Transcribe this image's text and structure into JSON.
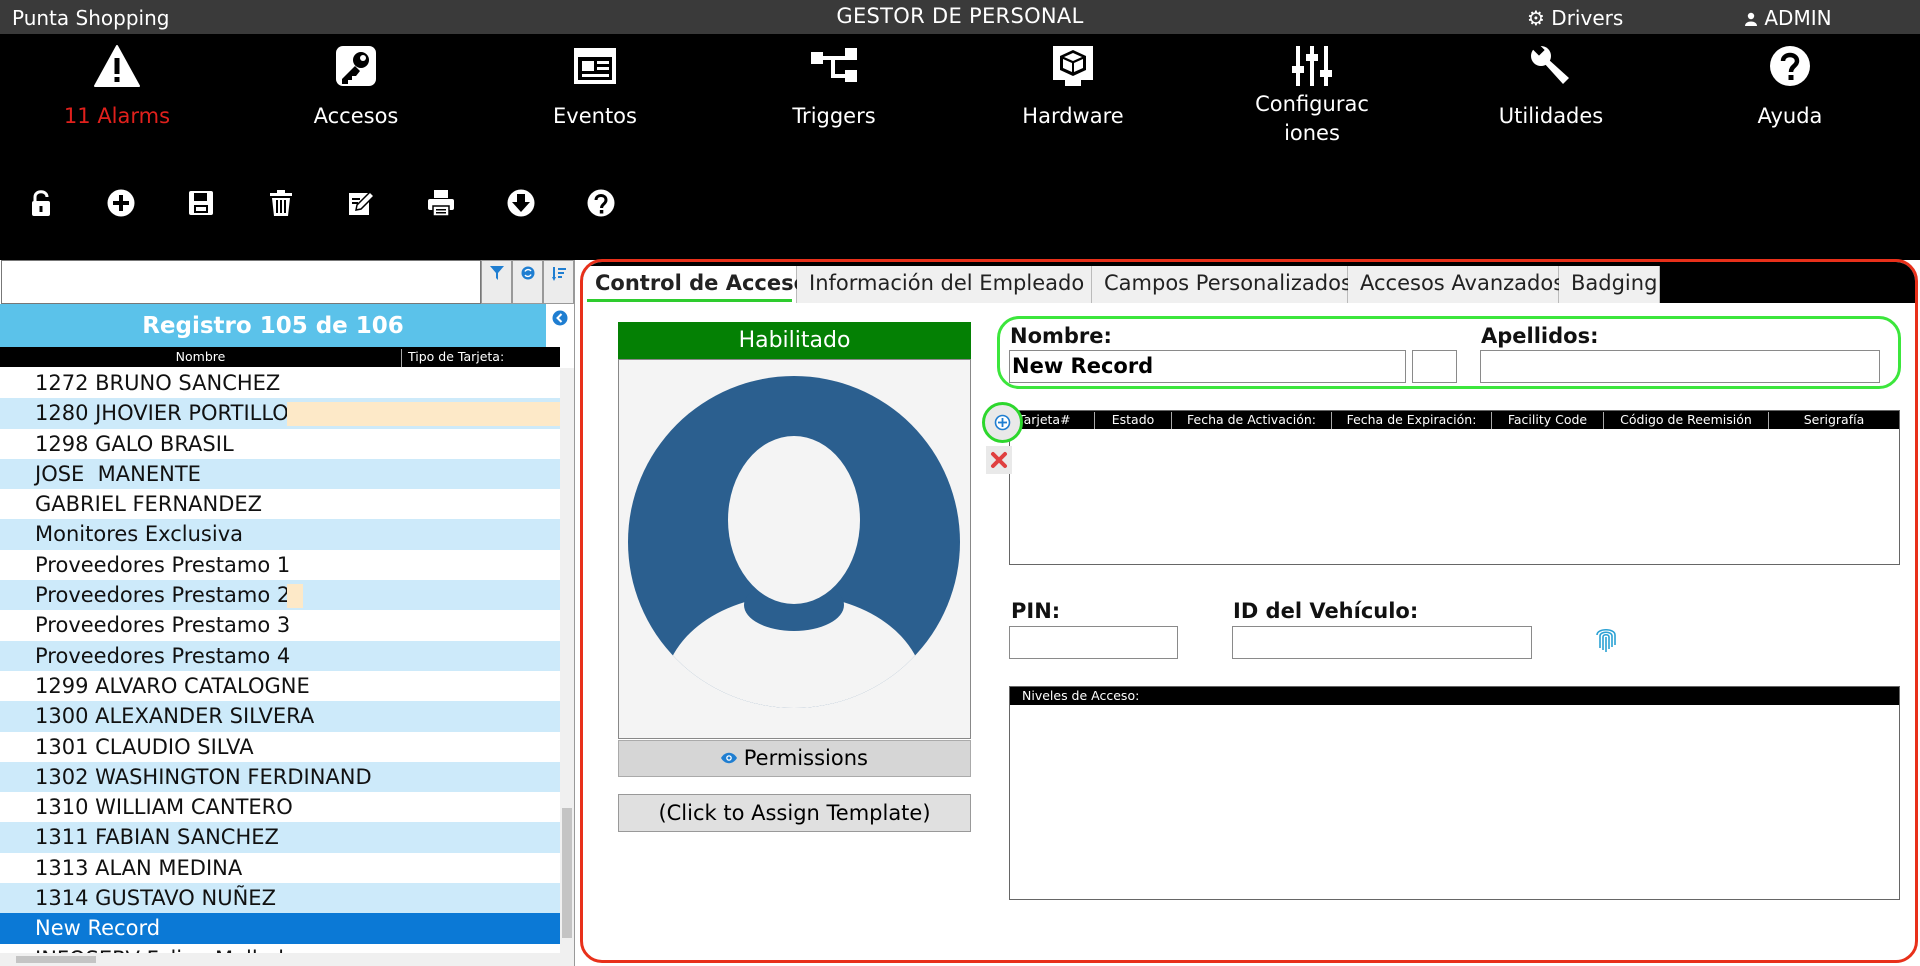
{
  "titlebar": {
    "app_name": "Punta Shopping",
    "title": "GESTOR DE PERSONAL",
    "drivers": "Drivers",
    "admin": "ADMIN"
  },
  "nav": [
    {
      "label": "11 Alarms",
      "icon": "warning-icon"
    },
    {
      "label": "Accesos",
      "icon": "key-icon"
    },
    {
      "label": "Eventos",
      "icon": "news-icon"
    },
    {
      "label": "Triggers",
      "icon": "flow-icon"
    },
    {
      "label": "Hardware",
      "icon": "cube-icon"
    },
    {
      "label": "Configuraciones",
      "icon": "sliders-icon"
    },
    {
      "label": "Utilidades",
      "icon": "wrench-icon"
    },
    {
      "label": "Ayuda",
      "icon": "help-icon"
    }
  ],
  "toolbar": [
    "lock-icon",
    "add-icon",
    "save-icon",
    "delete-icon",
    "edit-icon",
    "print-icon",
    "download-icon",
    "help-icon"
  ],
  "left_panel": {
    "header": "Registro 105 de 106",
    "col_name": "Nombre",
    "col_card": "Tipo de Tarjeta:",
    "rows": [
      "1272 BRUNO SANCHEZ",
      "1280 JHOVIER PORTILLO",
      "1298 GALO BRASIL",
      "JOSE  MANENTE",
      "GABRIEL FERNANDEZ",
      "Monitores Exclusiva",
      "Proveedores Prestamo 1",
      "Proveedores Prestamo 2",
      "Proveedores Prestamo 3",
      "Proveedores Prestamo 4",
      "1299 ALVARO CATALOGNE",
      "1300 ALEXANDER SILVERA",
      "1301 CLAUDIO SILVA",
      "1302 WASHINGTON FERDINAND",
      "1310 WILLIAM CANTERO",
      "1311 FABIAN SANCHEZ",
      "1313 ALAN MEDINA",
      "1314 GUSTAVO NUÑEZ",
      "New Record",
      "INFOSERV Felipe Mallada"
    ]
  },
  "tabs": [
    "Control de Accesos",
    "Información del Empleado",
    "Campos Personalizados",
    "Accesos Avanzados",
    "Badging"
  ],
  "form": {
    "status": "Habilitado",
    "permissions": "Permissions",
    "template": "(Click to Assign Template)",
    "nombre_label": "Nombre:",
    "nombre_value": "New Record",
    "apellidos_label": "Apellidos:",
    "apellidos_value": "",
    "pin_label": "PIN:",
    "vehiculo_label": "ID del Vehículo:",
    "niveles_label": "Niveles de Acceso:"
  },
  "card_grid": {
    "columns": [
      "Tarjeta#",
      "Estado",
      "Fecha de Activación:",
      "Fecha de Expiración:",
      "Facility Code",
      "Código de Reemisión",
      "Serigrafía"
    ]
  },
  "colors": {
    "accent_red": "#e8301a",
    "highlight_green": "#3ce63c",
    "status_green": "#048004",
    "header_blue": "#5bc2ea",
    "selected_blue": "#0b79d6"
  }
}
